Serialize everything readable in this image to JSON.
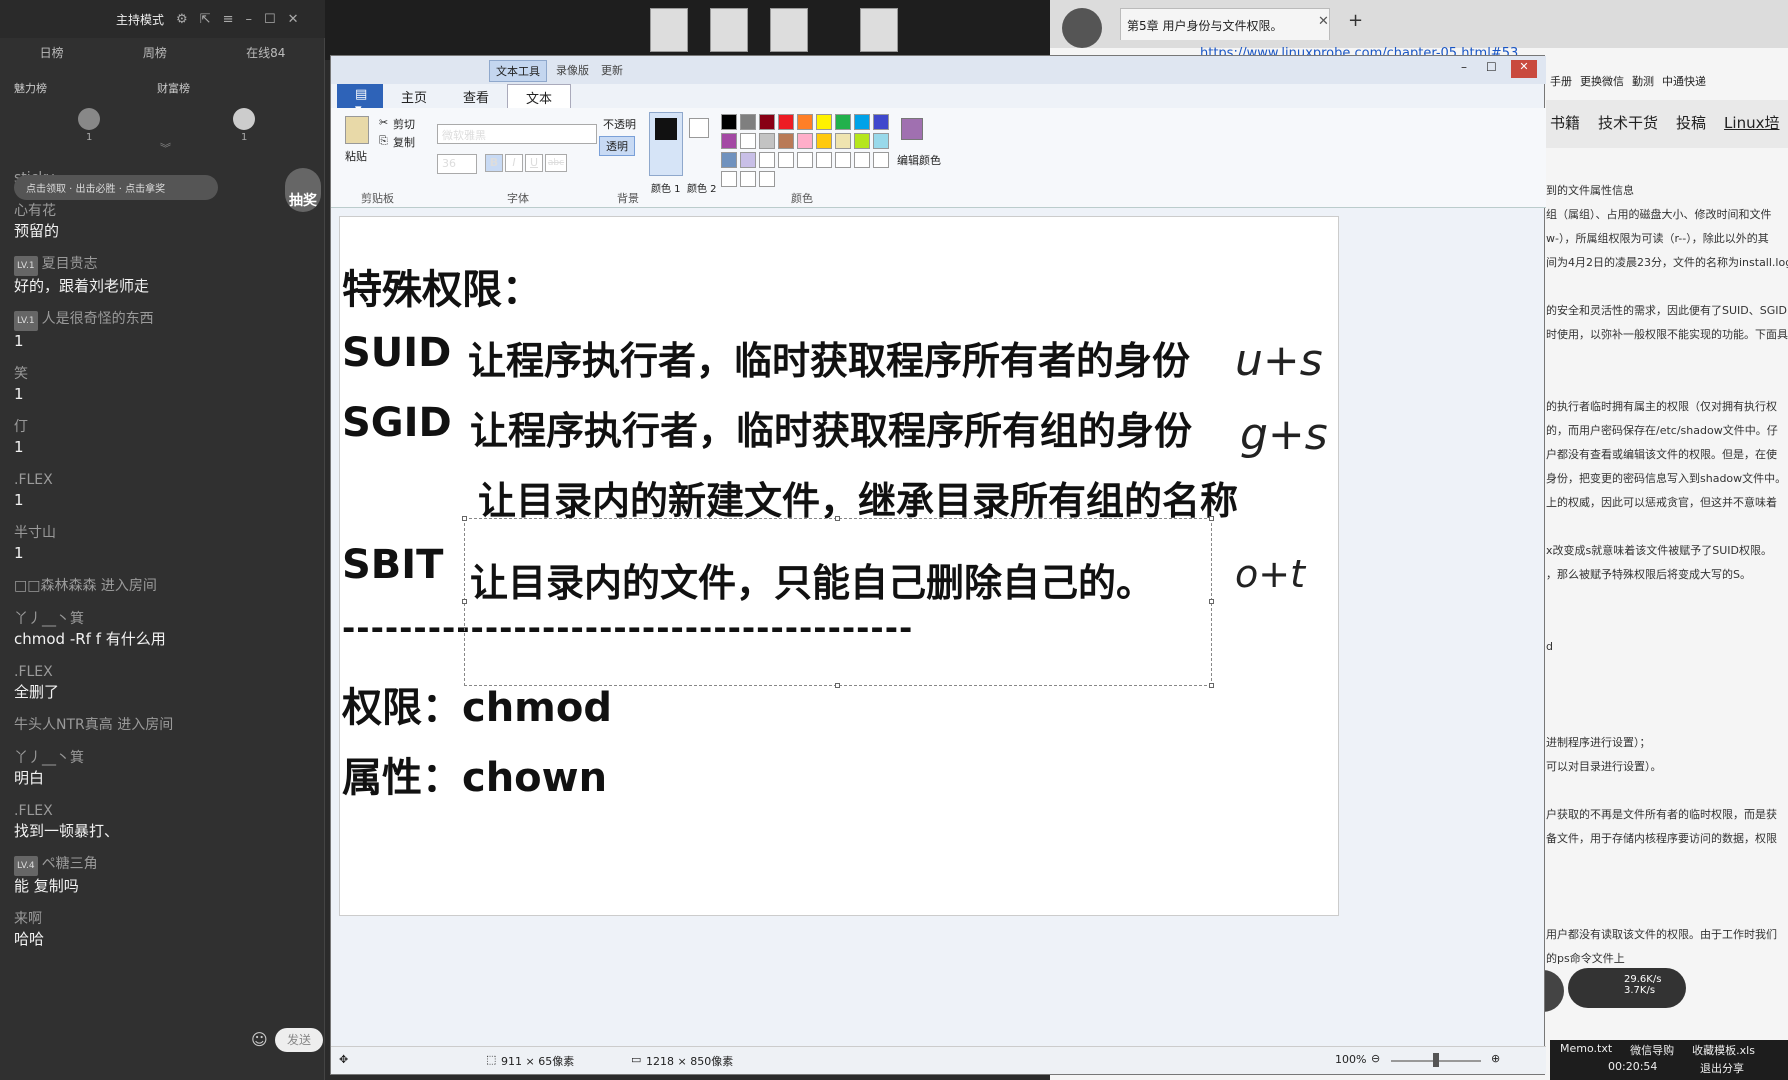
{
  "chat": {
    "mode_title": "主持模式",
    "tabs": [
      "日榜",
      "周榜",
      "在线84"
    ],
    "rank_labels": [
      "魅力榜",
      "财富榜"
    ],
    "rank_counts": [
      "1",
      "1"
    ],
    "notice": "点击领取 · 出击必胜 · 点击拿奖",
    "lottery_label": "抽奖",
    "messages": [
      {
        "user": "sticky",
        "text": ""
      },
      {
        "user": "心有花",
        "text": "预留的"
      },
      {
        "user": "夏目贵志",
        "level": "LV.1",
        "text": "好的，跟着刘老师走"
      },
      {
        "user": "人是很奇怪的东西",
        "level": "LV.1",
        "text": "1"
      },
      {
        "user": "笑",
        "text": "1"
      },
      {
        "user": "仃",
        "text": "1"
      },
      {
        "user": ".FLEX",
        "text": "1"
      },
      {
        "user": "半寸山",
        "text": "1"
      },
      {
        "user": "□□森林森森 进入房间",
        "text": ""
      },
      {
        "user": "丫丿__丶箕",
        "text": "chmod -Rf      f 有什么用"
      },
      {
        "user": ".FLEX",
        "text": "全删了"
      },
      {
        "user": "牛头人NTR真高 进入房间",
        "text": ""
      },
      {
        "user": "丫丿__丶箕",
        "text": "明白"
      },
      {
        "user": ".FLEX",
        "text": "找到一顿暴打、"
      },
      {
        "user": "ペ糖三角",
        "level": "LV.4",
        "text": "能 复制吗"
      },
      {
        "user": "来啊",
        "text": "哈哈"
      }
    ],
    "send_label": "发送"
  },
  "browser": {
    "tab_title": "第5章 用户身份与文件权限。",
    "url": "https://www.linuxprobe.com/chapter-05.html#53",
    "bookmarks": [
      "手册",
      "更换微信",
      "勤测",
      "中通快递"
    ],
    "nav": [
      "书籍",
      "技术干货",
      "投稿",
      "Linux培"
    ],
    "article_lines": [
      "到的文件属性信息",
      "组（属组）、占用的磁盘大小、修改时间和文件",
      "w-），所属组权限为可读（r--），除此以外的其",
      "间为4月2日的凌晨23分，文件的名称为install.log",
      "",
      "的安全和灵活性的需求，因此便有了SUID、SGID",
      "时使用，以弥补一般权限不能实现的功能。下面具",
      "",
      "",
      "的执行者临时拥有属主的权限（仅对拥有执行权",
      "的，而用户密码保存在/etc/shadow文件中。仔",
      "户都没有查看或编辑该文件的权限。但是，在使",
      "身份，把变更的密码信息写入到shadow文件中。",
      "上的权威，因此可以惩戒贪官，但这并不意味着",
      "",
      "x改变成s就意味着该文件被赋予了SUID权限。",
      "，那么被赋予特殊权限后将变成大写的S。",
      "",
      "",
      "d",
      "",
      "",
      "",
      "进制程序进行设置）；",
      "可以对目录进行设置）。",
      "",
      "户获取的不再是文件所有者的临时权限，而是获",
      "备文件，用于存储内核程序要访问的数据，权限",
      "",
      "",
      "",
      "用户都没有读取该文件的权限。由于工作时我们",
      "的ps命令文件上"
    ],
    "net_speed_up": "29.6K/s",
    "net_speed_down": "3.7K/s",
    "taskbar_items": [
      "Memo.txt",
      "微信导购",
      "收藏模板.xls"
    ],
    "timer": "00:20:54",
    "exit_share": "退出分享"
  },
  "paint": {
    "context_tab": "文本工具",
    "title_tabs": [
      "录像版",
      "更新"
    ],
    "tabs": [
      "主页",
      "查看",
      "文本"
    ],
    "clipboard": {
      "paste": "粘贴",
      "cut": "剪切",
      "copy": "复制",
      "label": "剪贴板"
    },
    "font": {
      "name": "微软雅黑",
      "size": "36",
      "label": "字体",
      "bold": "B",
      "italic": "I",
      "underline": "U",
      "strike": "abc"
    },
    "background": {
      "opaque": "不透明",
      "transparent": "透明",
      "label": "背景"
    },
    "colors": {
      "color1": "颜色 1",
      "color2": "颜色 2",
      "edit": "编辑颜色",
      "label": "颜色"
    },
    "palette": [
      "#000000",
      "#7f7f7f",
      "#880015",
      "#ed1c24",
      "#ff7f27",
      "#fff200",
      "#22b14c",
      "#00a2e8",
      "#3f48cc",
      "#a349a4",
      "#ffffff",
      "#c3c3c3",
      "#b97a57",
      "#ffaec9",
      "#ffc90e",
      "#efe4b0",
      "#b5e61d",
      "#99d9ea",
      "#7092be",
      "#c8bfe7"
    ],
    "canvas_lines": {
      "heading": "特殊权限：",
      "suid_label": "SUID",
      "suid_text": "让程序执行者，临时获取程序所有者的身份",
      "suid_hw": "u+s",
      "sgid_label": "SGID",
      "sgid_text": "让程序执行者，临时获取程序所有组的身份",
      "sgid_hw": "g+s",
      "sgid_text2": "让目录内的新建文件，继承目录所有组的名称",
      "sbit_label": "SBIT",
      "sbit_text": "让目录内的文件，只能自己删除自己的。",
      "sbit_hw": "o+t",
      "divider": "----------------------------------------",
      "perm_line": "权限：chmod",
      "attr_line": "属性：chown"
    },
    "status": {
      "selection": "911 × 65像素",
      "image_size": "1218 × 850像素",
      "zoom": "100%"
    }
  }
}
